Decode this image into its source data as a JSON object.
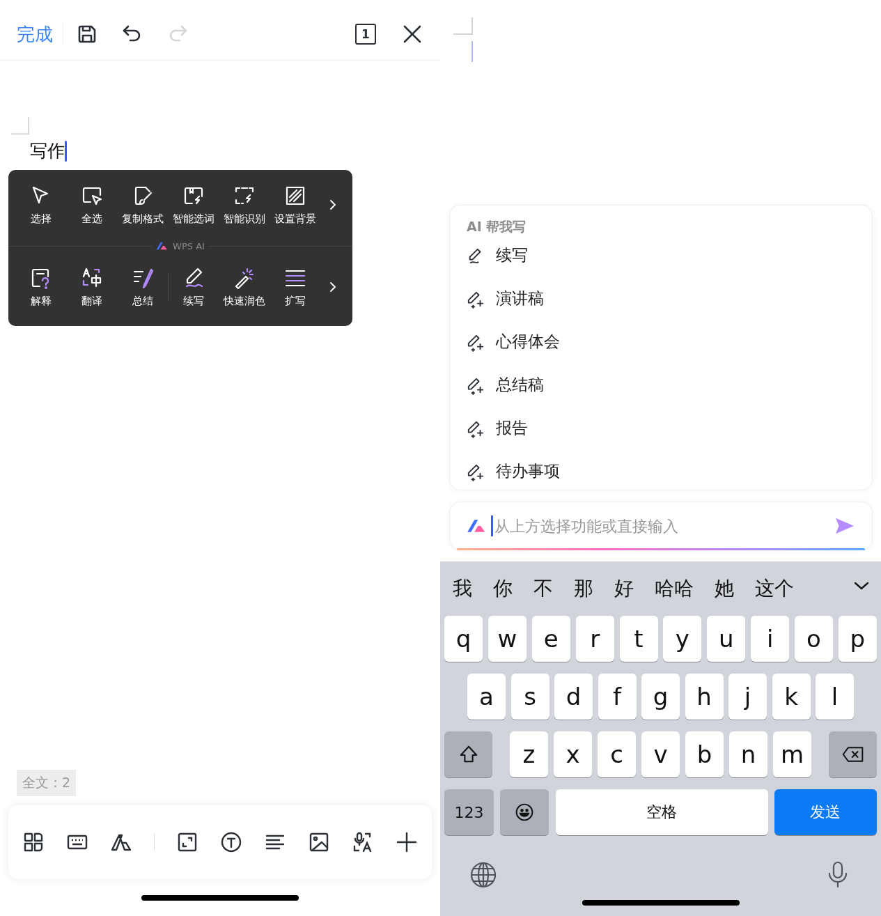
{
  "toolbar": {
    "done": "完成",
    "page_count": "1",
    "redo": {
      "disabled": true
    }
  },
  "document": {
    "text": "写作"
  },
  "context_menu": {
    "row_1": [
      {
        "label": "选择",
        "kind": "cursor"
      },
      {
        "label": "全选",
        "kind": "select-all"
      },
      {
        "label": "复制格式",
        "kind": "brush"
      },
      {
        "label": "智能选词",
        "kind": "smart-word"
      },
      {
        "label": "智能识别",
        "kind": "smart-scan"
      },
      {
        "label": "设置背景",
        "kind": "background"
      }
    ],
    "brand": "WPS AI",
    "row_2": [
      {
        "label": "解释",
        "kind": "explain"
      },
      {
        "label": "翻译",
        "kind": "translate"
      },
      {
        "label": "总结",
        "kind": "summary"
      },
      {
        "label": "续写",
        "kind": "continue"
      },
      {
        "label": "快速润色",
        "kind": "polish"
      },
      {
        "label": "扩写",
        "kind": "expand"
      }
    ]
  },
  "word_count": "全文：2",
  "ai_panel": {
    "heading": "AI 帮我写",
    "items": [
      {
        "label": "续写",
        "kind": "pen"
      },
      {
        "label": "演讲稿",
        "kind": "sparkle-pen"
      },
      {
        "label": "心得体会",
        "kind": "sparkle-pen"
      },
      {
        "label": "总结稿",
        "kind": "sparkle-pen"
      },
      {
        "label": "报告",
        "kind": "sparkle-pen"
      },
      {
        "label": "待办事项",
        "kind": "sparkle-pen"
      }
    ],
    "input": {
      "placeholder": "从上方选择功能或直接输入"
    }
  },
  "keyboard": {
    "candidates": [
      "我",
      "你",
      "不",
      "那",
      "好",
      "哈哈",
      "她",
      "这个"
    ],
    "rows": [
      [
        "q",
        "w",
        "e",
        "r",
        "t",
        "y",
        "u",
        "i",
        "o",
        "p"
      ],
      [
        "a",
        "s",
        "d",
        "f",
        "g",
        "h",
        "j",
        "k",
        "l"
      ],
      [
        "z",
        "x",
        "c",
        "v",
        "b",
        "n",
        "m"
      ]
    ],
    "numbers": "123",
    "space": "空格",
    "send": "发送"
  }
}
